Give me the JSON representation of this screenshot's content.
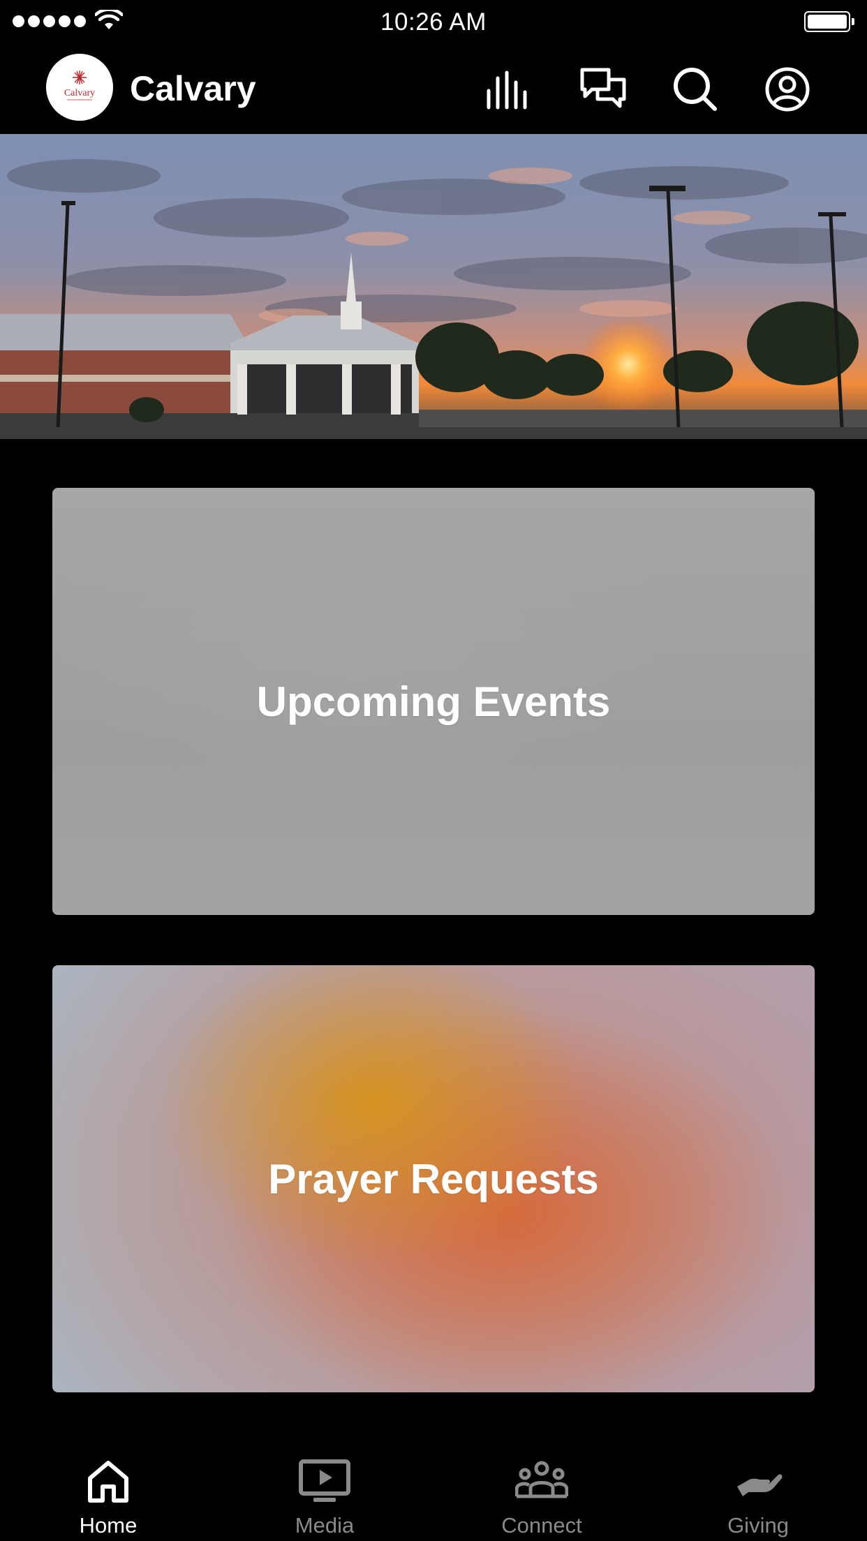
{
  "status_bar": {
    "time": "10:26 AM",
    "signal_bars": 5,
    "battery_level": 1.0
  },
  "header": {
    "app_title": "Calvary",
    "logo_text": "Calvary",
    "icons": [
      "audio-bars-icon",
      "chat-icon",
      "search-icon",
      "account-icon"
    ]
  },
  "hero": {
    "image": "church-at-sunrise"
  },
  "cards": [
    {
      "label": "Upcoming Events"
    },
    {
      "label": "Prayer Requests"
    }
  ],
  "tabs": [
    {
      "label": "Home",
      "icon": "home-icon",
      "active": true
    },
    {
      "label": "Media",
      "icon": "tv-play-icon",
      "active": false
    },
    {
      "label": "Connect",
      "icon": "group-icon",
      "active": false
    },
    {
      "label": "Giving",
      "icon": "giving-hand-icon",
      "active": false
    }
  ],
  "colors": {
    "background": "#000000",
    "active_tab": "#ffffff",
    "inactive_tab": "#8a8a8a",
    "logo_red": "#c0272d"
  }
}
